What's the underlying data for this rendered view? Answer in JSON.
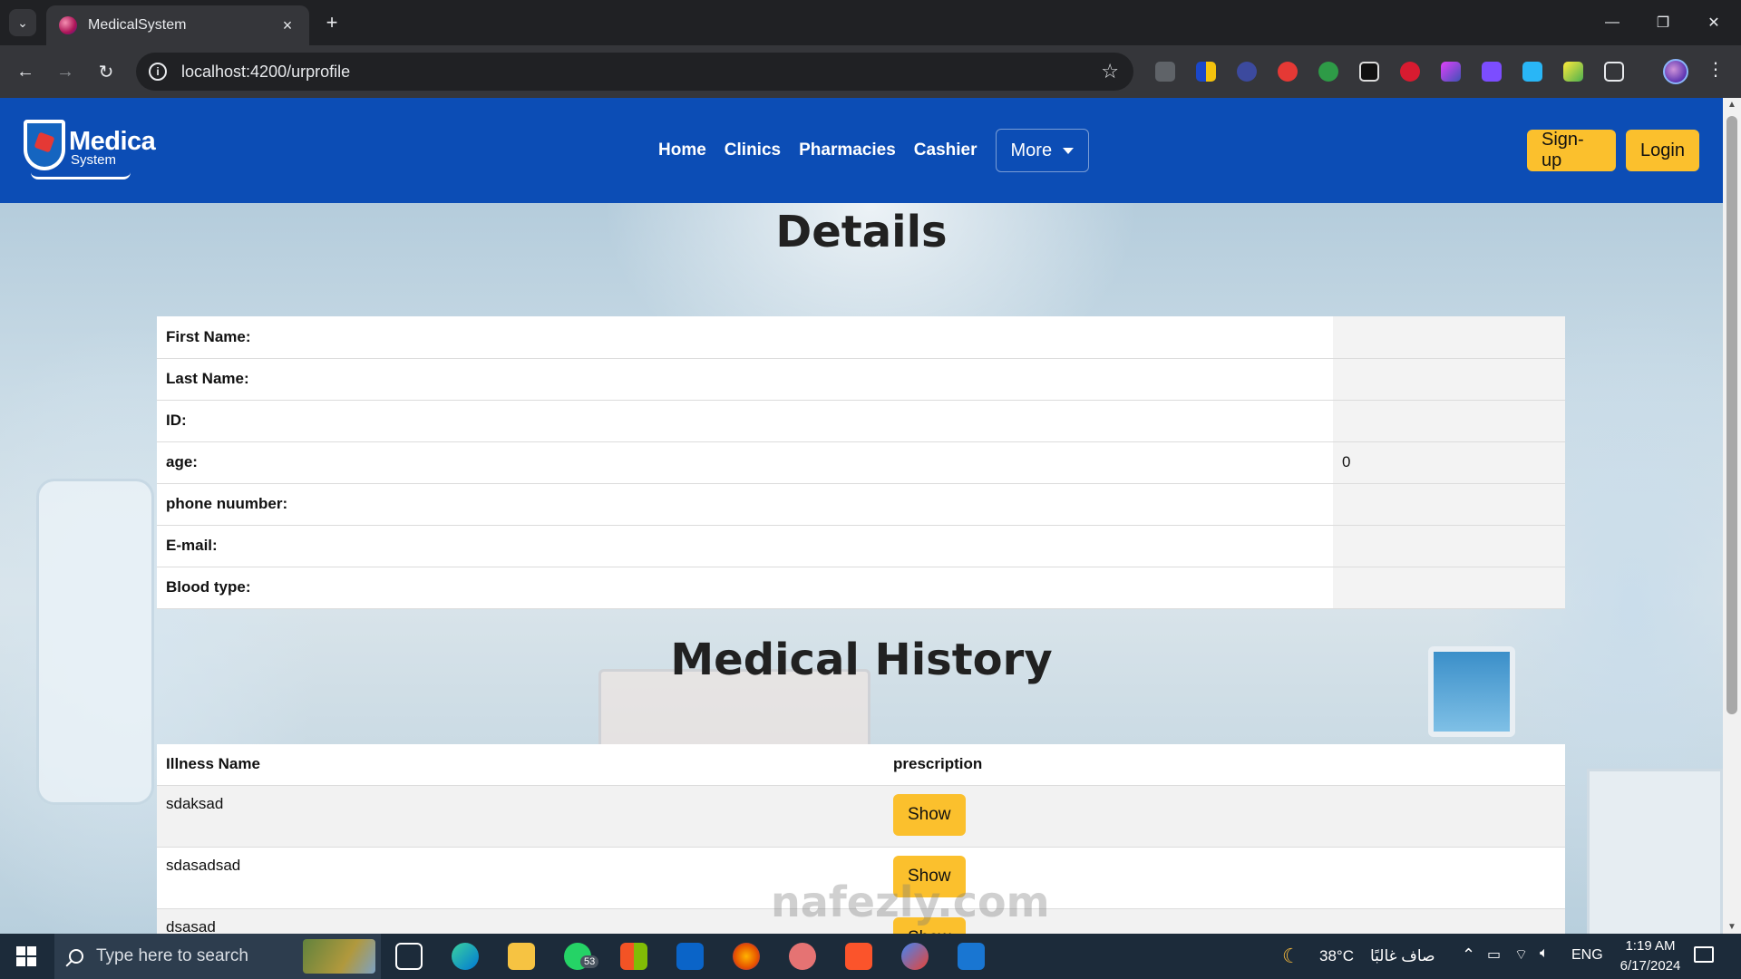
{
  "browser": {
    "tab_title": "MedicalSystem",
    "url": "localhost:4200/urprofile"
  },
  "site": {
    "logo_word1": "Medica",
    "logo_word2": "System",
    "nav": {
      "home": "Home",
      "clinics": "Clinics",
      "pharmacies": "Pharmacies",
      "cashier": "Cashier",
      "more": "More"
    },
    "signup": "Sign-up",
    "login": "Login"
  },
  "details": {
    "title": "Details",
    "rows": [
      {
        "label": "First Name:",
        "value": ""
      },
      {
        "label": "Last Name:",
        "value": ""
      },
      {
        "label": "ID:",
        "value": ""
      },
      {
        "label": "age:",
        "value": "0"
      },
      {
        "label": "phone nuumber:",
        "value": ""
      },
      {
        "label": "E-mail:",
        "value": ""
      },
      {
        "label": "Blood type:",
        "value": ""
      }
    ]
  },
  "history": {
    "title": "Medical History",
    "col_illness": "Illness Name",
    "col_prescription": "prescription",
    "rows": [
      {
        "illness": "sdaksad",
        "button": "Show"
      },
      {
        "illness": "sdasadsad",
        "button": "Show"
      },
      {
        "illness": "dsasad",
        "button": "Show"
      }
    ]
  },
  "watermark": "nafezly.com",
  "taskbar": {
    "search_placeholder": "Type here to search",
    "whatsapp_badge": "53",
    "weather_temp": "38°C",
    "weather_desc": "صاف غالبًا",
    "language": "ENG",
    "time": "1:19 AM",
    "date": "6/17/2024"
  },
  "colors": {
    "site_nav": "#0c4db5",
    "button_yellow": "#fbc02d",
    "chrome_dark": "#202124",
    "chrome_toolbar": "#35363a",
    "taskbar": "#1c2b3a"
  }
}
